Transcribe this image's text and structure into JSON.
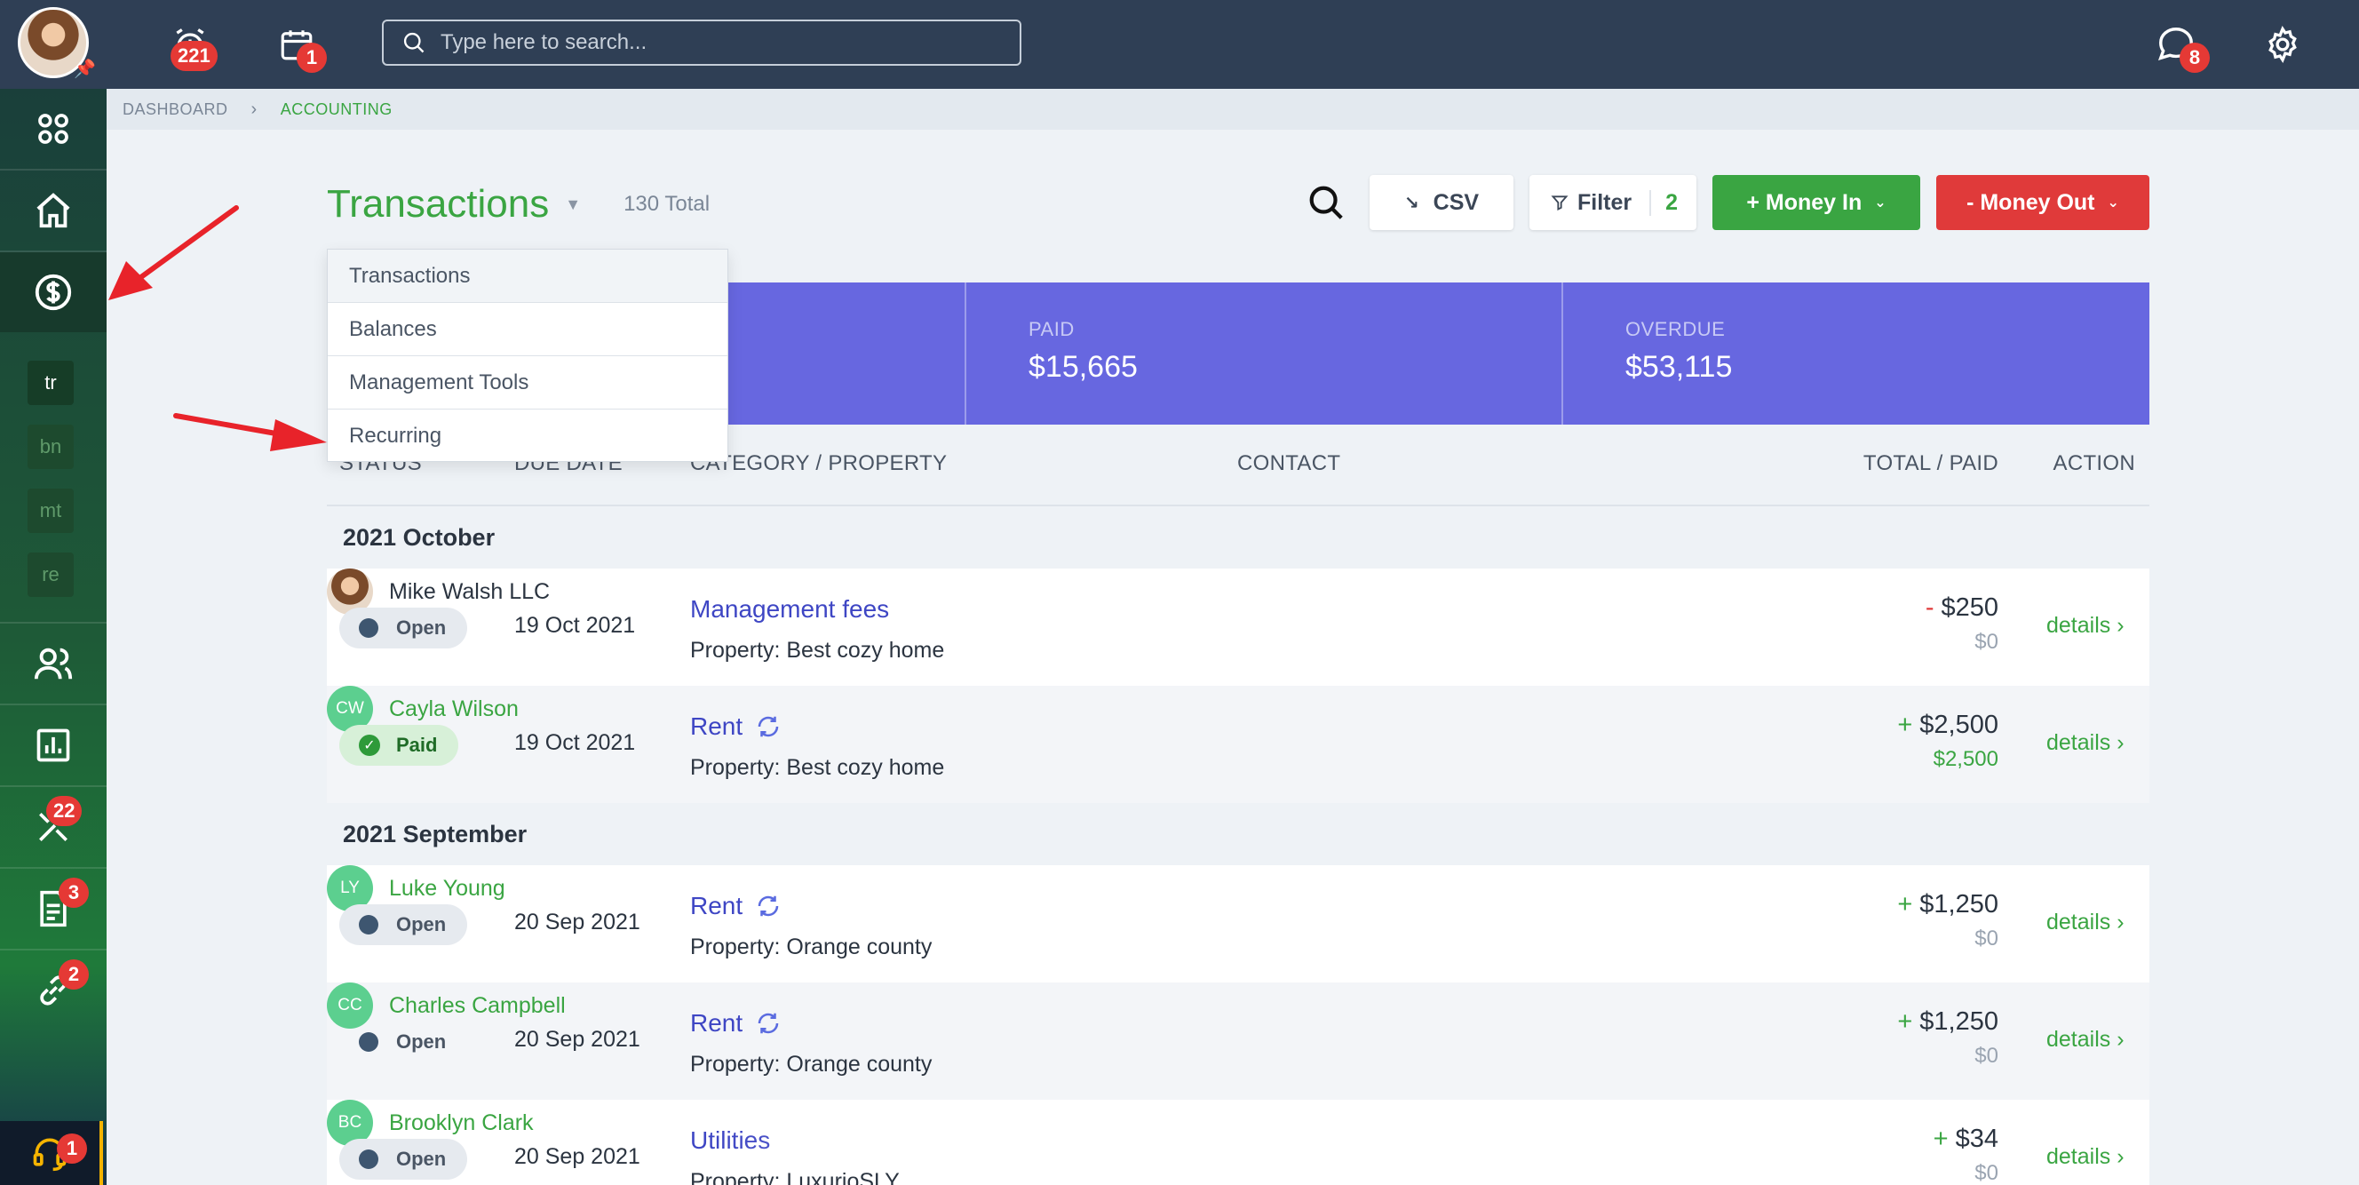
{
  "topbar": {
    "alarm_count": "221",
    "calendar_count": "1",
    "messages_count": "8",
    "search_placeholder": "Type here to search..."
  },
  "sidebar": {
    "tools_count": "22",
    "documents_count": "3",
    "links_count": "2",
    "support_count": "1",
    "sub_items": [
      "tr",
      "bn",
      "mt",
      "re"
    ]
  },
  "breadcrumb": {
    "root": "DASHBOARD",
    "current": "ACCOUNTING"
  },
  "header": {
    "title": "Transactions",
    "total": "130 Total",
    "csv": "CSV",
    "filter": "Filter",
    "filter_count": "2",
    "money_in": "+ Money In",
    "money_out": "- Money Out"
  },
  "dropdown": {
    "items": [
      "Transactions",
      "Balances",
      "Management Tools",
      "Recurring"
    ]
  },
  "stats": {
    "paid_label": "PAID",
    "paid_value": "$15,665",
    "overdue_label": "OVERDUE",
    "overdue_value": "$53,115"
  },
  "table": {
    "headers": {
      "status": "STATUS",
      "due_date": "DUE DATE",
      "category": "CATEGORY / PROPERTY",
      "contact": "CONTACT",
      "total": "TOTAL / PAID",
      "action": "ACTION"
    },
    "groups": [
      "2021 October",
      "2021 September"
    ],
    "rows": [
      {
        "status": "Open",
        "date": "19 Oct 2021",
        "category": "Management fees",
        "property": "Property: Best cozy home",
        "contact": "Mike Walsh LLC",
        "initials": "",
        "sign": "-",
        "total": "$250",
        "paid": "$0",
        "action": "details"
      },
      {
        "status": "Paid",
        "date": "19 Oct 2021",
        "category": "Rent",
        "property": "Property: Best cozy home",
        "contact": "Cayla Wilson",
        "initials": "CW",
        "sign": "+",
        "total": "$2,500",
        "paid": "$2,500",
        "action": "details"
      },
      {
        "status": "Open",
        "date": "20 Sep 2021",
        "category": "Rent",
        "property": "Property: Orange county",
        "contact": "Luke Young",
        "initials": "LY",
        "sign": "+",
        "total": "$1,250",
        "paid": "$0",
        "action": "details"
      },
      {
        "status": "Open",
        "date": "20 Sep 2021",
        "category": "Rent",
        "property": "Property: Orange county",
        "contact": "Charles Campbell",
        "initials": "CC",
        "sign": "+",
        "total": "$1,250",
        "paid": "$0",
        "action": "details"
      },
      {
        "status": "Open",
        "date": "20 Sep 2021",
        "category": "Utilities",
        "property": "Property: LuxurioSLY",
        "contact": "Brooklyn Clark",
        "initials": "BC",
        "sign": "+",
        "total": "$34",
        "paid": "$0",
        "action": "details"
      }
    ]
  },
  "colors": {
    "accent_green": "#3aa542",
    "money_out_red": "#e03a3a",
    "stats_purple": "#6767e0",
    "topbar": "#2f3f55",
    "annotation_arrow": "#e8232a"
  }
}
